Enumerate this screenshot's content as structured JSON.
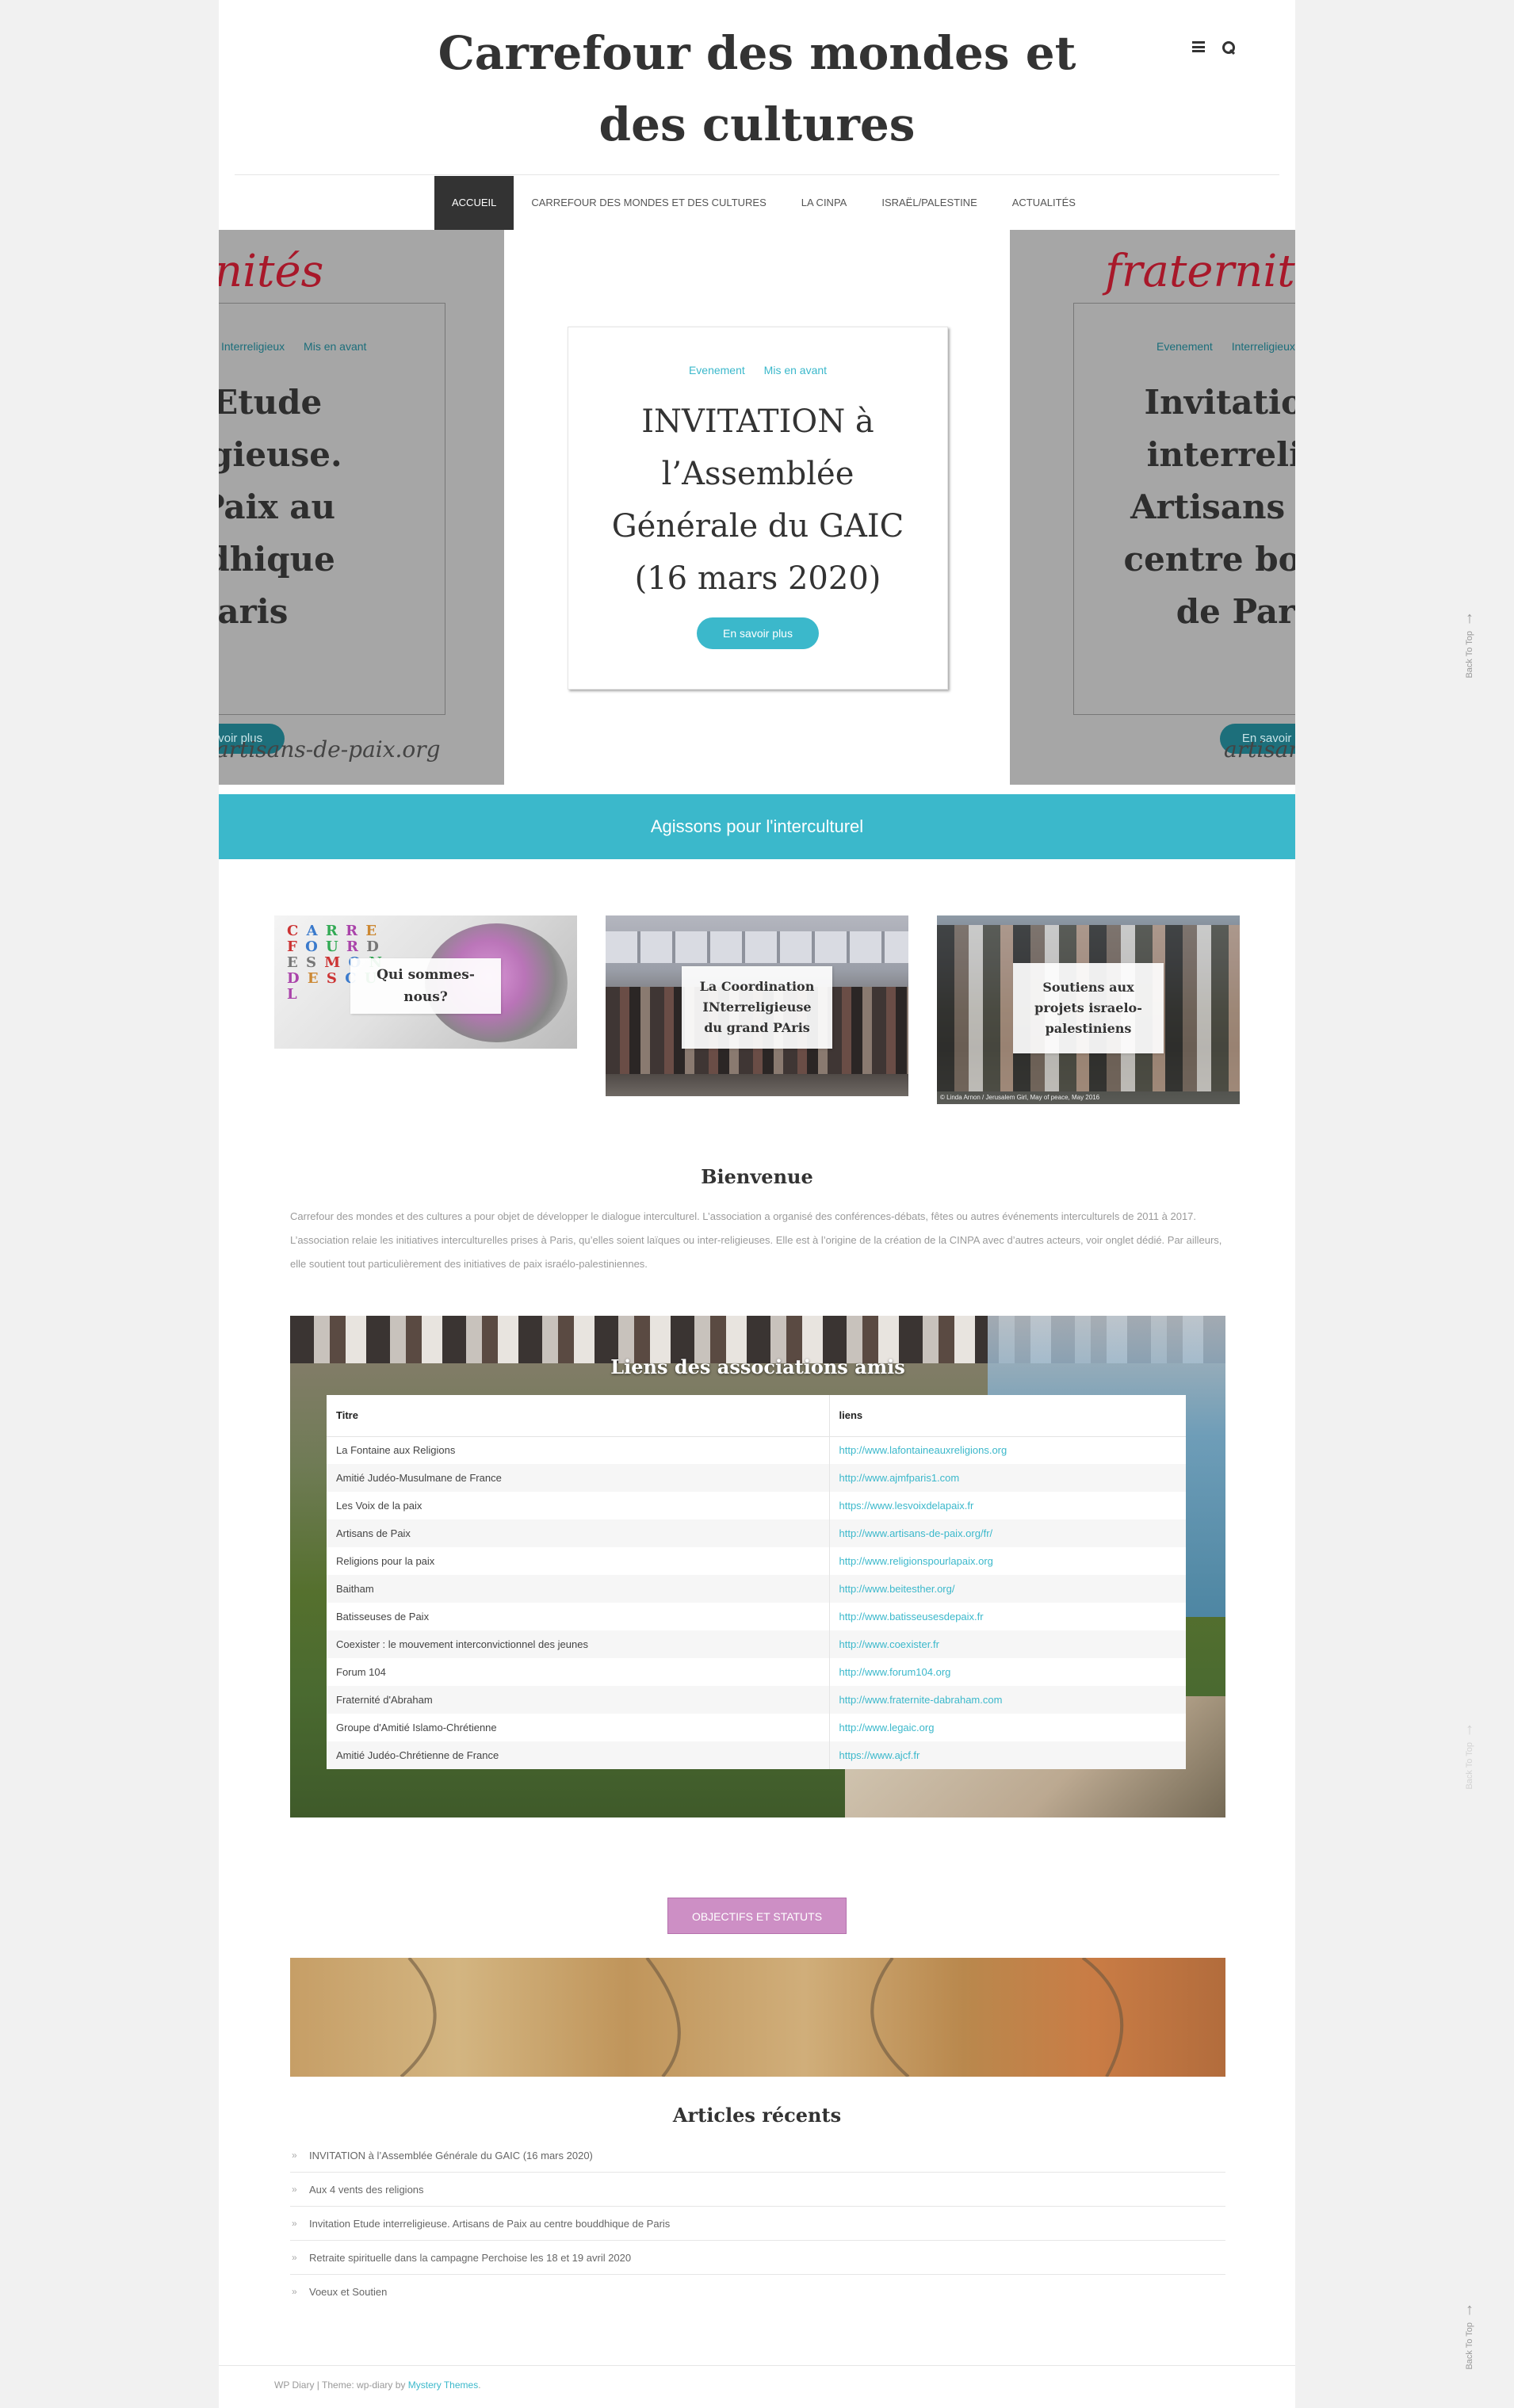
{
  "site": {
    "title_line1": "Carrefour des mondes et",
    "title_line2": "des cultures"
  },
  "header_icons": [
    "menu-icon",
    "search-icon"
  ],
  "nav": {
    "items": [
      {
        "label": "Accueil",
        "active": true
      },
      {
        "label": "Carrefour des mondes et des cultures",
        "active": false
      },
      {
        "label": "La CINPA",
        "active": false
      },
      {
        "label": "Israël/Palestine",
        "active": false
      },
      {
        "label": "Actualités",
        "active": false
      }
    ]
  },
  "slider": {
    "left": {
      "logo": "nités",
      "cat1": "Interreligieux",
      "cat2": "Mis en avant",
      "title_lines": [
        "tion Etude",
        "erreligieuse.",
        "s de Paix au",
        "bouddhique",
        "e Paris"
      ],
      "button": "En savoir plus",
      "site": "artisans-de-paix.org"
    },
    "center": {
      "cat1": "Evenement",
      "cat2": "Mis en avant",
      "title_lines": [
        "INVITATION à",
        "l’Assemblée",
        "Générale du GAIC",
        "(16 mars 2020)"
      ],
      "button": "En savoir plus"
    },
    "right": {
      "logo": "fraternité",
      "cat1": "Evenement",
      "cat2": "Interreligieux",
      "title_lines": [
        "Invitation",
        "interrelig",
        "Artisans de",
        "centre boud",
        "de Par"
      ],
      "button": "En savoir plus",
      "site": "artisans-"
    }
  },
  "banner": {
    "text": "Agissons pour l'interculturel"
  },
  "features": [
    {
      "label": "Qui sommes-nous?",
      "image_letters": [
        "C",
        "A",
        "R",
        "R",
        "E",
        "F",
        "O",
        "U",
        "R",
        "D",
        "E",
        "S",
        "M",
        "O",
        "N",
        "D",
        "E",
        "S",
        "C",
        "U",
        "L"
      ]
    },
    {
      "label": "La Coordination INterreligieuse du grand PAris"
    },
    {
      "label": "Soutiens aux projets israelo-palestiniens",
      "credit": "© Linda Arnon / Jerusalem Girl, May of peace, May 2016"
    }
  ],
  "welcome": {
    "title": "Bienvenue",
    "text": "Carrefour des mondes et des cultures a pour objet de développer le dialogue interculturel. L’association a organisé des conférences-débats, fêtes ou autres événements interculturels de 2011 à 2017. L’association relaie les initiatives interculturelles prises à Paris, qu’elles soient laïques ou inter-religieuses. Elle est à l’origine de la création de la CINPA avec d’autres acteurs, voir onglet dédié. Par ailleurs, elle soutient tout particulièrement des initiatives de paix israélo-palestiniennes."
  },
  "links": {
    "title": "Liens des associations amis",
    "columns": [
      "Titre",
      "liens"
    ],
    "rows": [
      [
        "La Fontaine aux Religions",
        "http://www.lafontaineauxreligions.org"
      ],
      [
        "Amitié Judéo-Musulmane de France",
        "http://www.ajmfparis1.com"
      ],
      [
        "Les Voix de la paix",
        "https://www.lesvoixdelapaix.fr"
      ],
      [
        "Artisans de Paix",
        "http://www.artisans-de-paix.org/fr/"
      ],
      [
        "Religions pour la paix",
        "http://www.religionspourlapaix.org"
      ],
      [
        "Baitham",
        "http://www.beitesther.org/"
      ],
      [
        "Batisseuses de Paix",
        "http://www.batisseusesdepaix.fr"
      ],
      [
        "Coexister : le mouvement interconvictionnel des jeunes",
        "http://www.coexister.fr"
      ],
      [
        "Forum 104",
        "http://www.forum104.org"
      ],
      [
        "Fraternité d'Abraham",
        "http://www.fraternite-dabraham.com"
      ],
      [
        "Groupe d'Amitié Islamo-Chrétienne",
        "http://www.legaic.org"
      ],
      [
        "Amitié Judéo-Chrétienne de France",
        "https://www.ajcf.fr"
      ]
    ]
  },
  "objectives": {
    "button": "Objectifs et statuts"
  },
  "recent": {
    "title": "Articles récents",
    "items": [
      "INVITATION à l’Assemblée Générale du GAIC (16 mars 2020)",
      "Aux 4 vents des religions",
      "Invitation Etude interreligieuse. Artisans de Paix au centre bouddhique de Paris",
      "Retraite spirituelle dans la campagne Perchoise les 18 et 19 avril 2020",
      "Voeux et Soutien"
    ]
  },
  "footer": {
    "prefix": "WP Diary | Theme: wp-diary by ",
    "link": "Mystery Themes",
    "suffix": "."
  },
  "back_to_top": {
    "label": "Back To Top"
  },
  "colors": {
    "accent": "#3bb8cb",
    "nav_active": "#333333",
    "objectives_button": "#cd8fc5"
  }
}
